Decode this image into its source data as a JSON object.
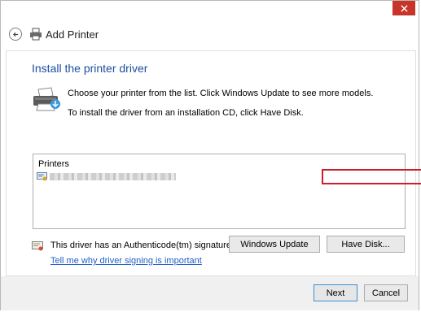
{
  "window": {
    "title": "Add Printer",
    "close_icon": "close-icon",
    "close_color": "#c7352a"
  },
  "content": {
    "heading": "Install the printer driver",
    "instruction_line1": "Choose your printer from the list. Click Windows Update to see more models.",
    "instruction_line2": "To install the driver from an installation CD, click Have Disk.",
    "heading_color": "#1d4fa0"
  },
  "printers_list": {
    "header": "Printers"
  },
  "signature": {
    "text": "This driver has an Authenticode(tm) signature.",
    "link": "Tell me why driver signing is important"
  },
  "buttons": {
    "windows_update": "Windows Update",
    "have_disk": "Have Disk...",
    "next": "Next",
    "cancel": "Cancel"
  },
  "highlight_color": "#cf1e2b"
}
